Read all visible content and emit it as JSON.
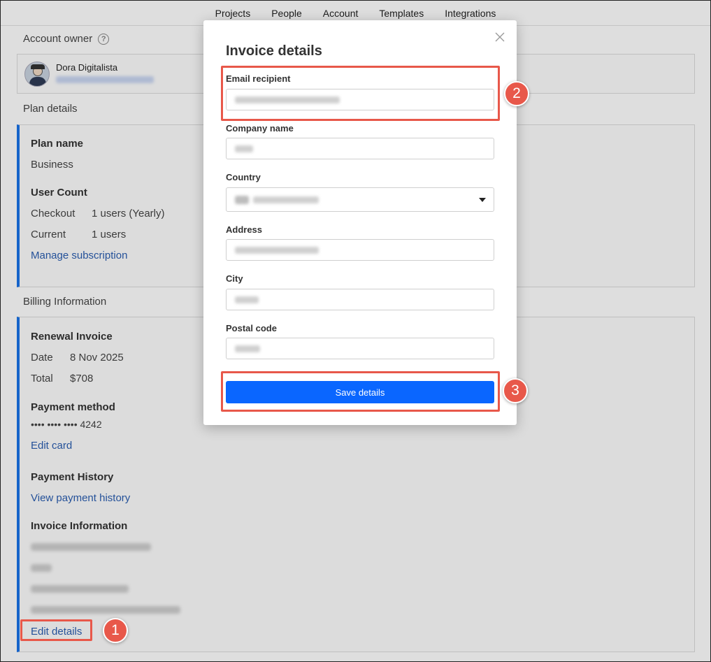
{
  "topnav": {
    "items": [
      "Projects",
      "People",
      "Account",
      "Templates",
      "Integrations"
    ]
  },
  "account_owner": {
    "title": "Account owner",
    "help": "?",
    "name": "Dora Digitalista"
  },
  "plan_details": {
    "title": "Plan details",
    "plan_name_label": "Plan name",
    "plan_name_value": "Business",
    "user_count_label": "User Count",
    "checkout_label": "Checkout",
    "checkout_value": "1 users (Yearly)",
    "current_label": "Current",
    "current_value": "1 users",
    "manage_link": "Manage subscription"
  },
  "billing": {
    "title": "Billing Information",
    "renewal_label": "Renewal Invoice",
    "date_label": "Date",
    "date_value": "8 Nov 2025",
    "total_label": "Total",
    "total_value": "$708",
    "payment_method_label": "Payment method",
    "card_number": "•••• •••• •••• 4242",
    "edit_card_link": "Edit card",
    "payment_history_label": "Payment History",
    "view_history_link": "View payment history",
    "invoice_info_label": "Invoice Information",
    "edit_details_link": "Edit details"
  },
  "modal": {
    "title": "Invoice details",
    "email_label": "Email recipient",
    "company_label": "Company name",
    "country_label": "Country",
    "address_label": "Address",
    "city_label": "City",
    "postal_label": "Postal code",
    "save_label": "Save details"
  },
  "annotations": {
    "step1": "1",
    "step2": "2",
    "step3": "3",
    "color": "#e8584a"
  },
  "colors": {
    "accent": "#1a73e8",
    "link": "#2a5db0",
    "primary_button": "#0a66ff"
  }
}
